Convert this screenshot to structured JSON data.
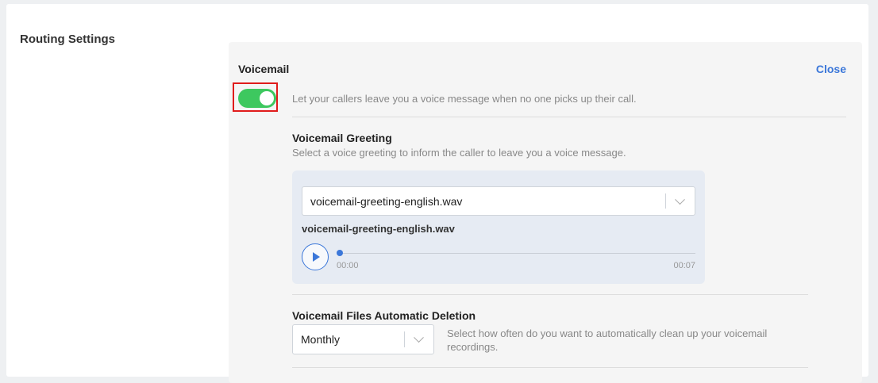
{
  "section": {
    "title": "Routing Settings"
  },
  "voicemail": {
    "title": "Voicemail",
    "close_label": "Close",
    "toggle_on": true,
    "toggle_description": "Let your callers leave you a voice message when no one picks up their call."
  },
  "greeting": {
    "title": "Voicemail Greeting",
    "description": "Select a voice greeting to inform the caller to leave you a voice message.",
    "selected_file": "voicemail-greeting-english.wav",
    "file_label": "voicemail-greeting-english.wav",
    "player": {
      "current_time": "00:00",
      "duration": "00:07",
      "progress": 0
    }
  },
  "deletion": {
    "title": "Voicemail Files Automatic Deletion",
    "selected": "Monthly",
    "description": "Select how often do you want to automatically clean up your voicemail recordings."
  },
  "colors": {
    "accent": "#3b77d9",
    "toggle_on": "#3dc85f",
    "highlight": "#e01b1b"
  }
}
